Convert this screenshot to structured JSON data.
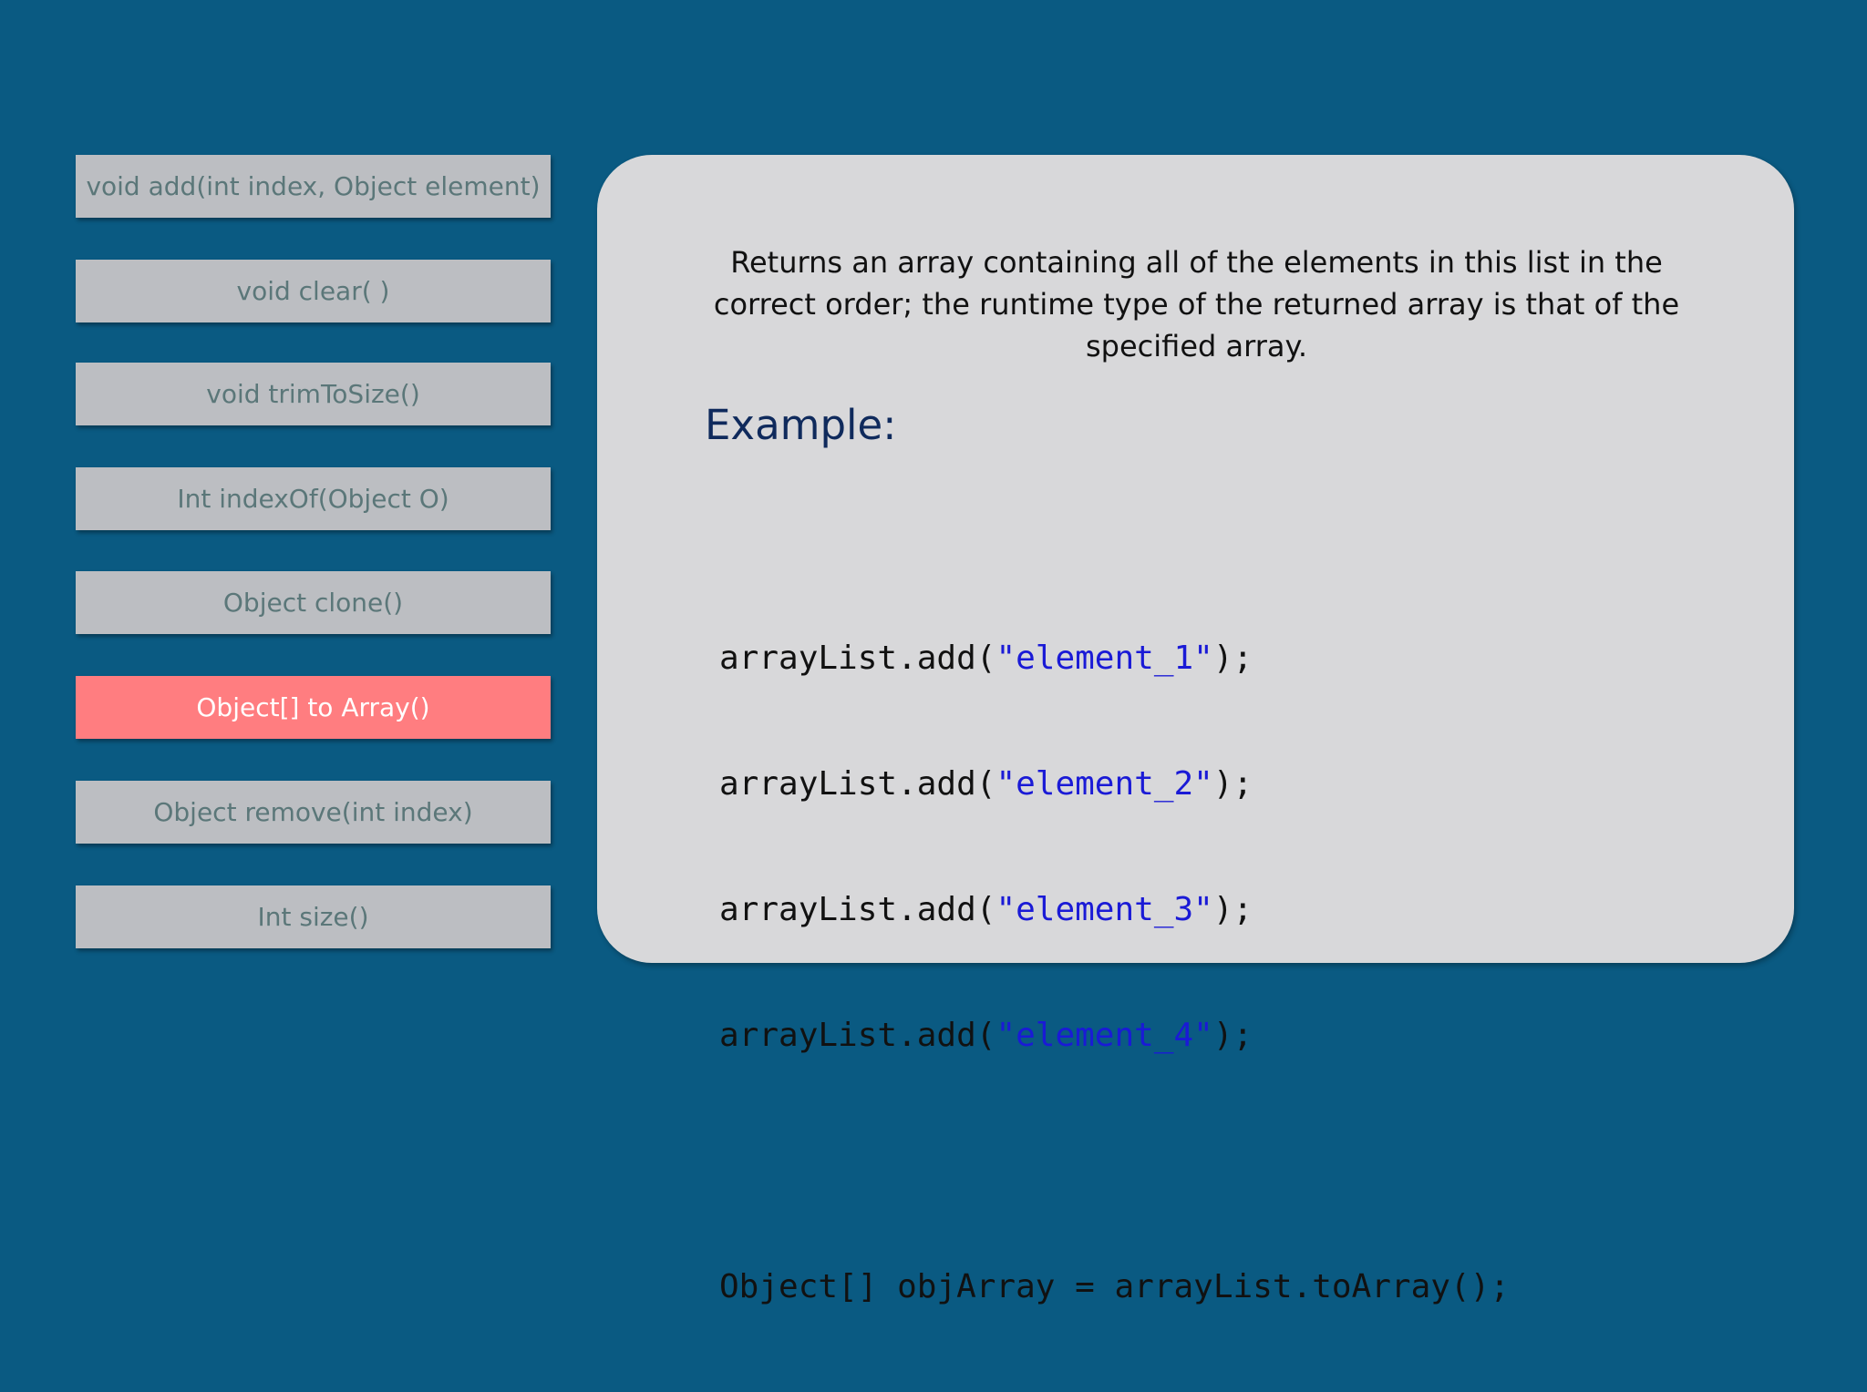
{
  "methods": [
    {
      "label": "void add(int index, Object element)",
      "active": false
    },
    {
      "label": "void clear( )",
      "active": false
    },
    {
      "label": "void trimToSize()",
      "active": false
    },
    {
      "label": "Int indexOf(Object O)",
      "active": false
    },
    {
      "label": "Object clone()",
      "active": false
    },
    {
      "label": "Object[] to Array()",
      "active": true
    },
    {
      "label": "Object remove(int index)",
      "active": false
    },
    {
      "label": "Int size()",
      "active": false
    }
  ],
  "detail": {
    "description": "Returns an array containing all of the elements in this list in the correct order; the runtime type of the returned array is that of the specified array.",
    "example_heading": "Example:",
    "code_lines": [
      {
        "prefix": "arrayList.add(",
        "string": "\"element_1\"",
        "suffix": ");"
      },
      {
        "prefix": "arrayList.add(",
        "string": "\"element_2\"",
        "suffix": ");"
      },
      {
        "prefix": "arrayList.add(",
        "string": "\"element_3\"",
        "suffix": ");"
      },
      {
        "prefix": "arrayList.add(",
        "string": "\"element_4\"",
        "suffix": ");"
      }
    ],
    "code_final": "Object[] objArray = arrayList.toArray();"
  },
  "colors": {
    "background": "#0a5a82",
    "button": "#bcbec2",
    "button_text": "#5b7779",
    "active_button": "#ff7d80",
    "panel": "#d8d8da",
    "heading": "#0f2a5c",
    "code_string": "#1a1ad6"
  }
}
